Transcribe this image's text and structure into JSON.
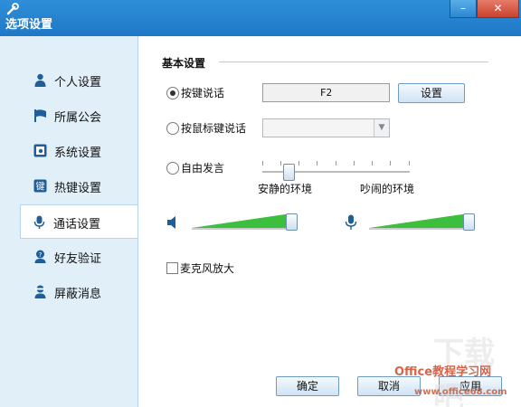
{
  "window": {
    "title": "选项设置",
    "minimize_label": "–",
    "close_label": "✕",
    "app_icon": "wrench-icon"
  },
  "sidebar": {
    "items": [
      {
        "label": "个人设置",
        "icon": "person-icon",
        "active": false
      },
      {
        "label": "所属公会",
        "icon": "flag-icon",
        "active": false
      },
      {
        "label": "系统设置",
        "icon": "window-settings-icon",
        "active": false
      },
      {
        "label": "热键设置",
        "icon": "key-icon",
        "active": false
      },
      {
        "label": "通话设置",
        "icon": "microphone-icon",
        "active": true
      },
      {
        "label": "好友验证",
        "icon": "person-question-icon",
        "active": false
      },
      {
        "label": "屏蔽消息",
        "icon": "person-block-icon",
        "active": false
      }
    ]
  },
  "main": {
    "section_title": "基本设置",
    "talk_modes": {
      "push_to_talk": {
        "label": "按键说话",
        "checked": true,
        "hotkey_value": "F2",
        "set_button": "设置"
      },
      "mouse_talk": {
        "label": "按鼠标键说话",
        "checked": false,
        "select_value": ""
      },
      "free_talk": {
        "label": "自由发言",
        "checked": false,
        "slider_left_label": "安静的环境",
        "slider_right_label": "吵闹的环境",
        "slider_level": 0.18
      }
    },
    "speaker_volume": {
      "icon": "speaker-icon",
      "level": 1.0
    },
    "mic_volume": {
      "icon": "mic-small-icon",
      "level": 1.0
    },
    "mic_boost": {
      "label": "麦克风放大",
      "checked": false
    },
    "ok_button": "确定",
    "cancel_button": "取消",
    "apply_button": "应用"
  },
  "colors": {
    "titlebar": "#1f78c6",
    "volume_fill": "#3cbf3c",
    "sidebar_bg": "#e1eff9"
  },
  "watermark": {
    "line1": "下载吧",
    "line2": "Office教程学习网",
    "line3": "www.office68.com"
  }
}
